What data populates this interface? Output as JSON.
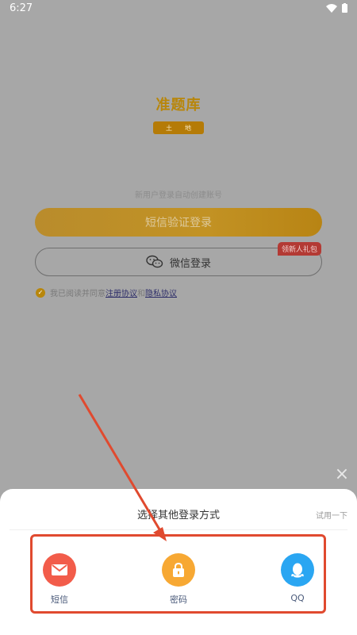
{
  "status_bar": {
    "time": "6:27"
  },
  "logo": {
    "title": "准题库",
    "badge_left": "土",
    "badge_right": "地"
  },
  "login": {
    "hint": "新用户登录自动创建账号",
    "sms_button": "短信验证登录",
    "wechat_button": "微信登录",
    "gift_badge": "领新人礼包"
  },
  "agreement": {
    "prefix": "我已阅读并同意",
    "register_link": "注册协议",
    "and": "和",
    "privacy_link": "隐私协议"
  },
  "sheet": {
    "title": "选择其他登录方式",
    "try_label": "试用一下",
    "options": [
      {
        "label": "短信",
        "icon": "mail-icon",
        "color": "#f25c4a"
      },
      {
        "label": "密码",
        "icon": "lock-icon",
        "color": "#f7a833"
      },
      {
        "label": "QQ",
        "icon": "qq-penguin-icon",
        "color": "#2aa6f2"
      }
    ]
  },
  "colors": {
    "accent": "#b8860b",
    "annotation": "#e04a2f"
  }
}
